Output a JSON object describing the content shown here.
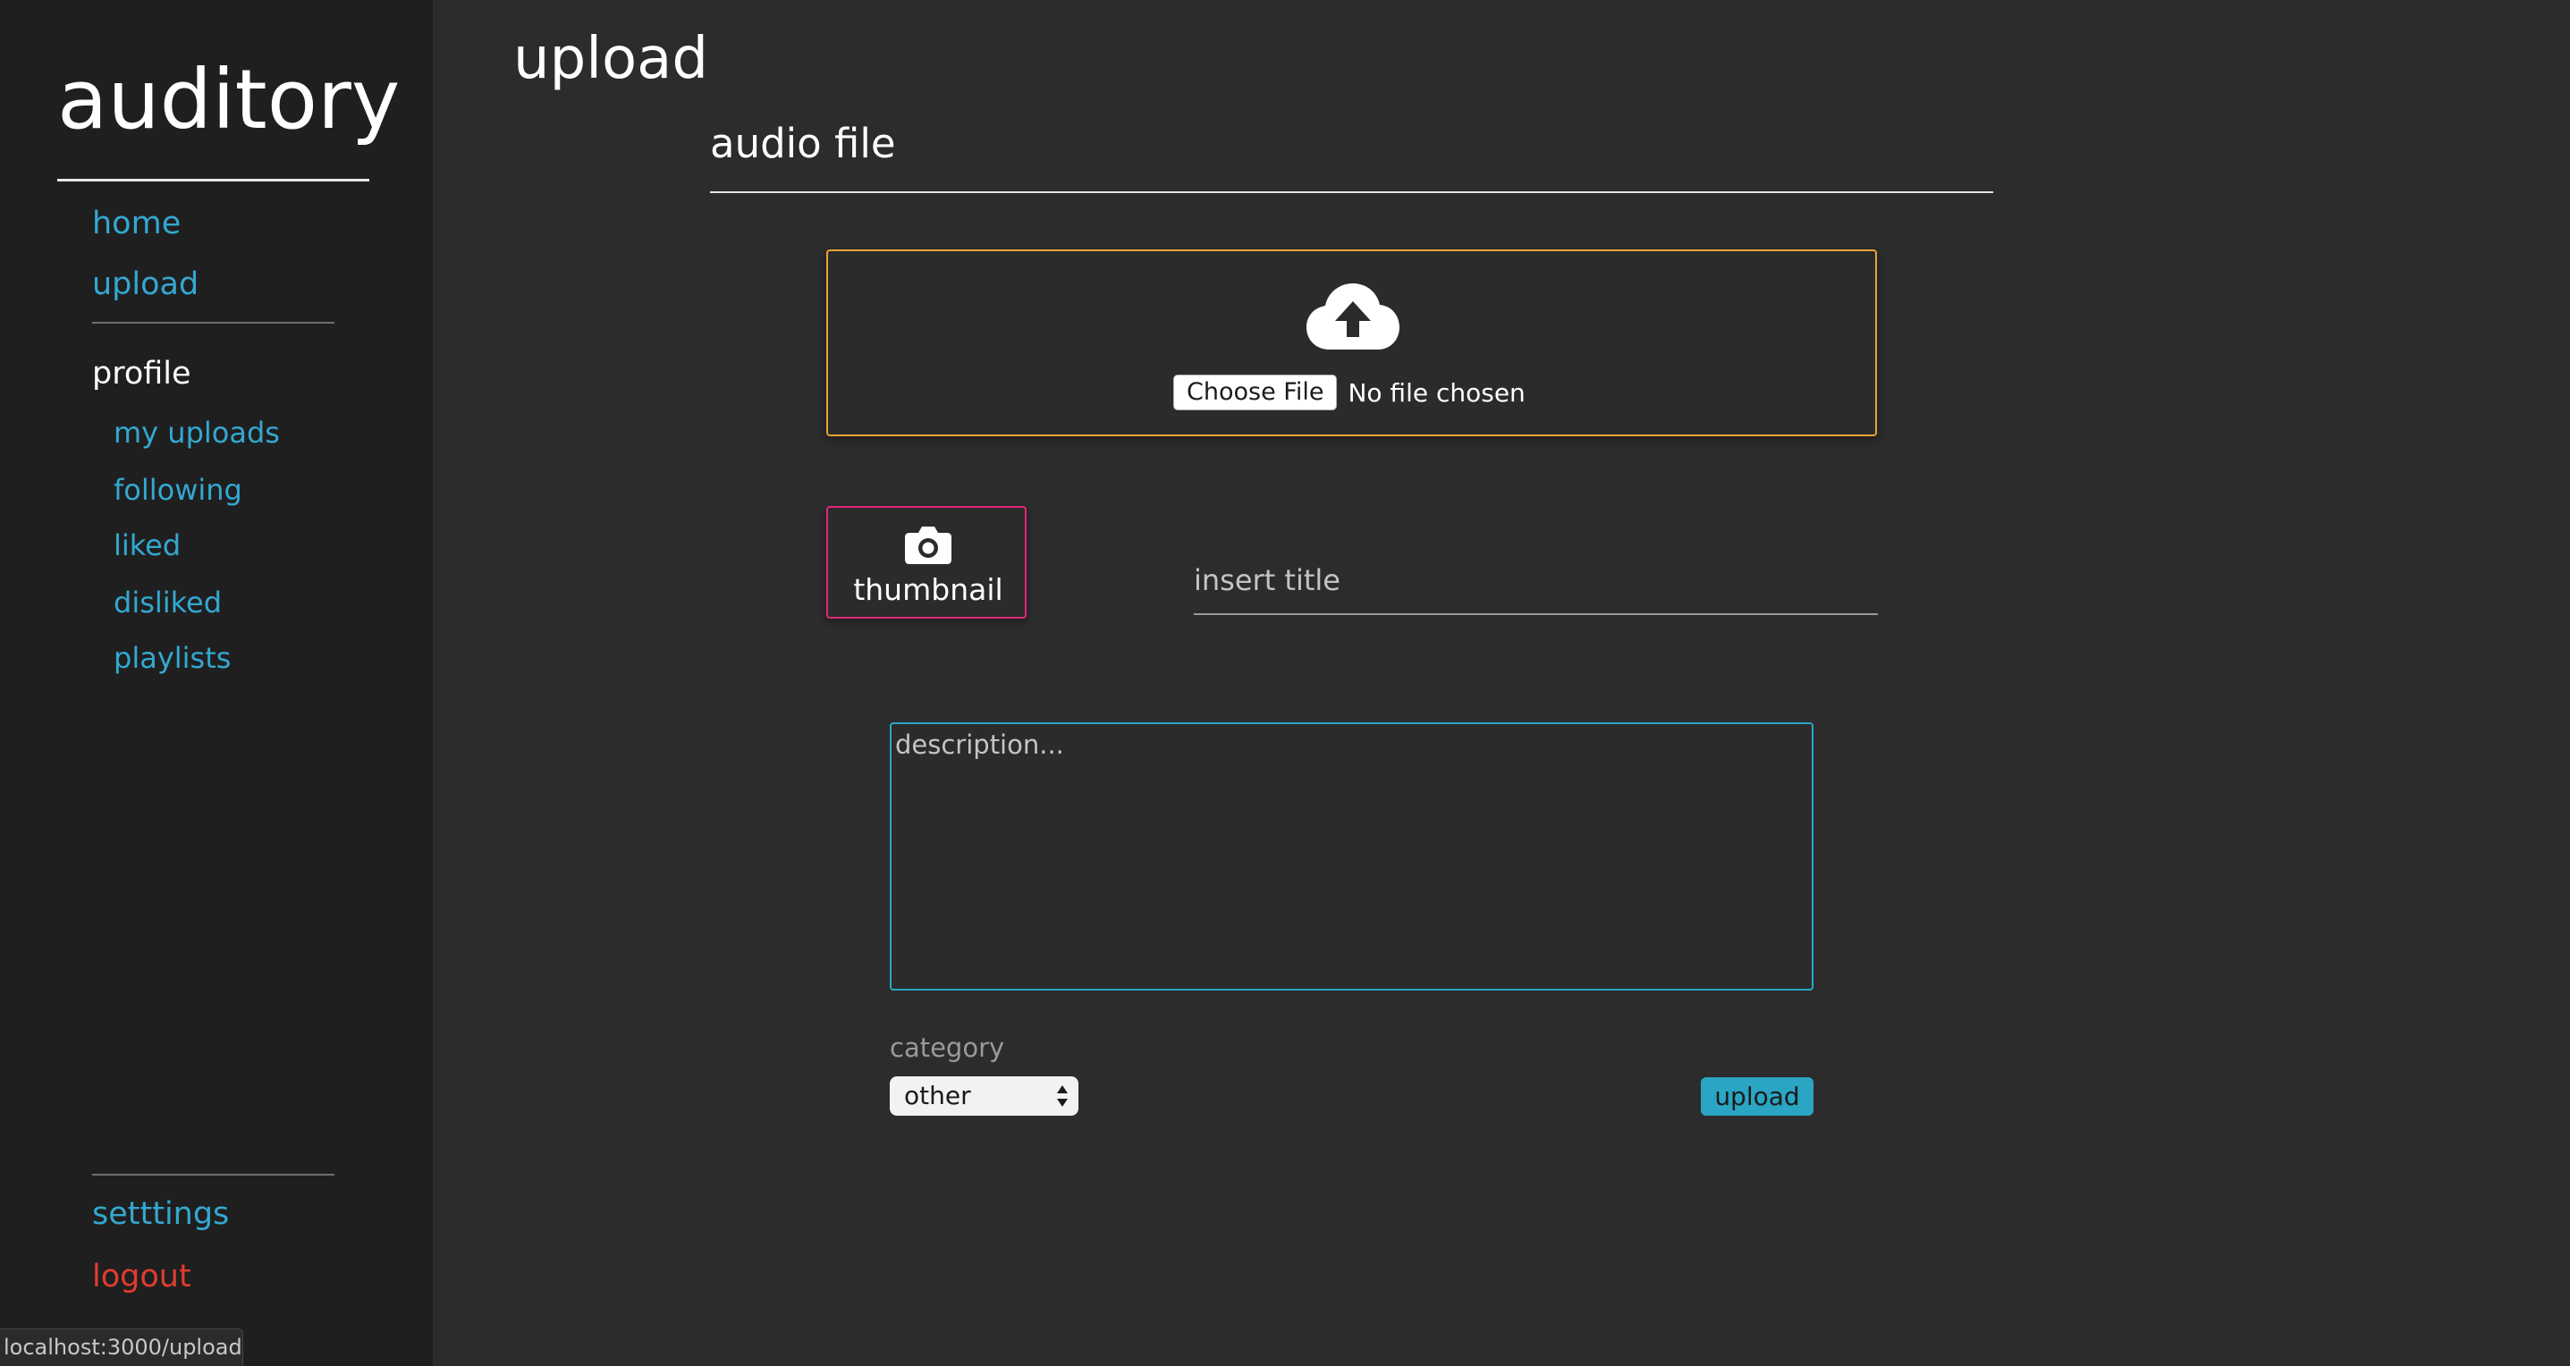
{
  "sidebar": {
    "brand": "auditory",
    "nav": [
      {
        "label": "home"
      },
      {
        "label": "upload"
      }
    ],
    "profile_heading": "profile",
    "profile_items": [
      {
        "label": "my uploads"
      },
      {
        "label": "following"
      },
      {
        "label": "liked"
      },
      {
        "label": "disliked"
      },
      {
        "label": "playlists"
      }
    ],
    "settings_label": "setttings",
    "logout_label": "logout"
  },
  "status_bar": {
    "url": "localhost:3000/upload"
  },
  "main": {
    "page_title": "upload",
    "audio_section_title": "audio file",
    "file_input": {
      "button_label": "Choose File",
      "status": "No file chosen",
      "icon": "cloud-upload-icon"
    },
    "thumbnail": {
      "label": "thumbnail",
      "icon": "camera-icon"
    },
    "title_input": {
      "placeholder": "insert title",
      "value": ""
    },
    "description": {
      "placeholder": "description...",
      "value": ""
    },
    "category": {
      "label": "category",
      "selected": "other"
    },
    "upload_button": "upload"
  },
  "colors": {
    "accent_link": "#33a8d1",
    "logout": "#e03c31",
    "dropzone_border": "#e8a33a",
    "thumbnail_border": "#e2277a",
    "description_border": "#2aa5c4",
    "sidebar_bg": "#1f1f1f",
    "main_bg": "#2c2c2c"
  }
}
